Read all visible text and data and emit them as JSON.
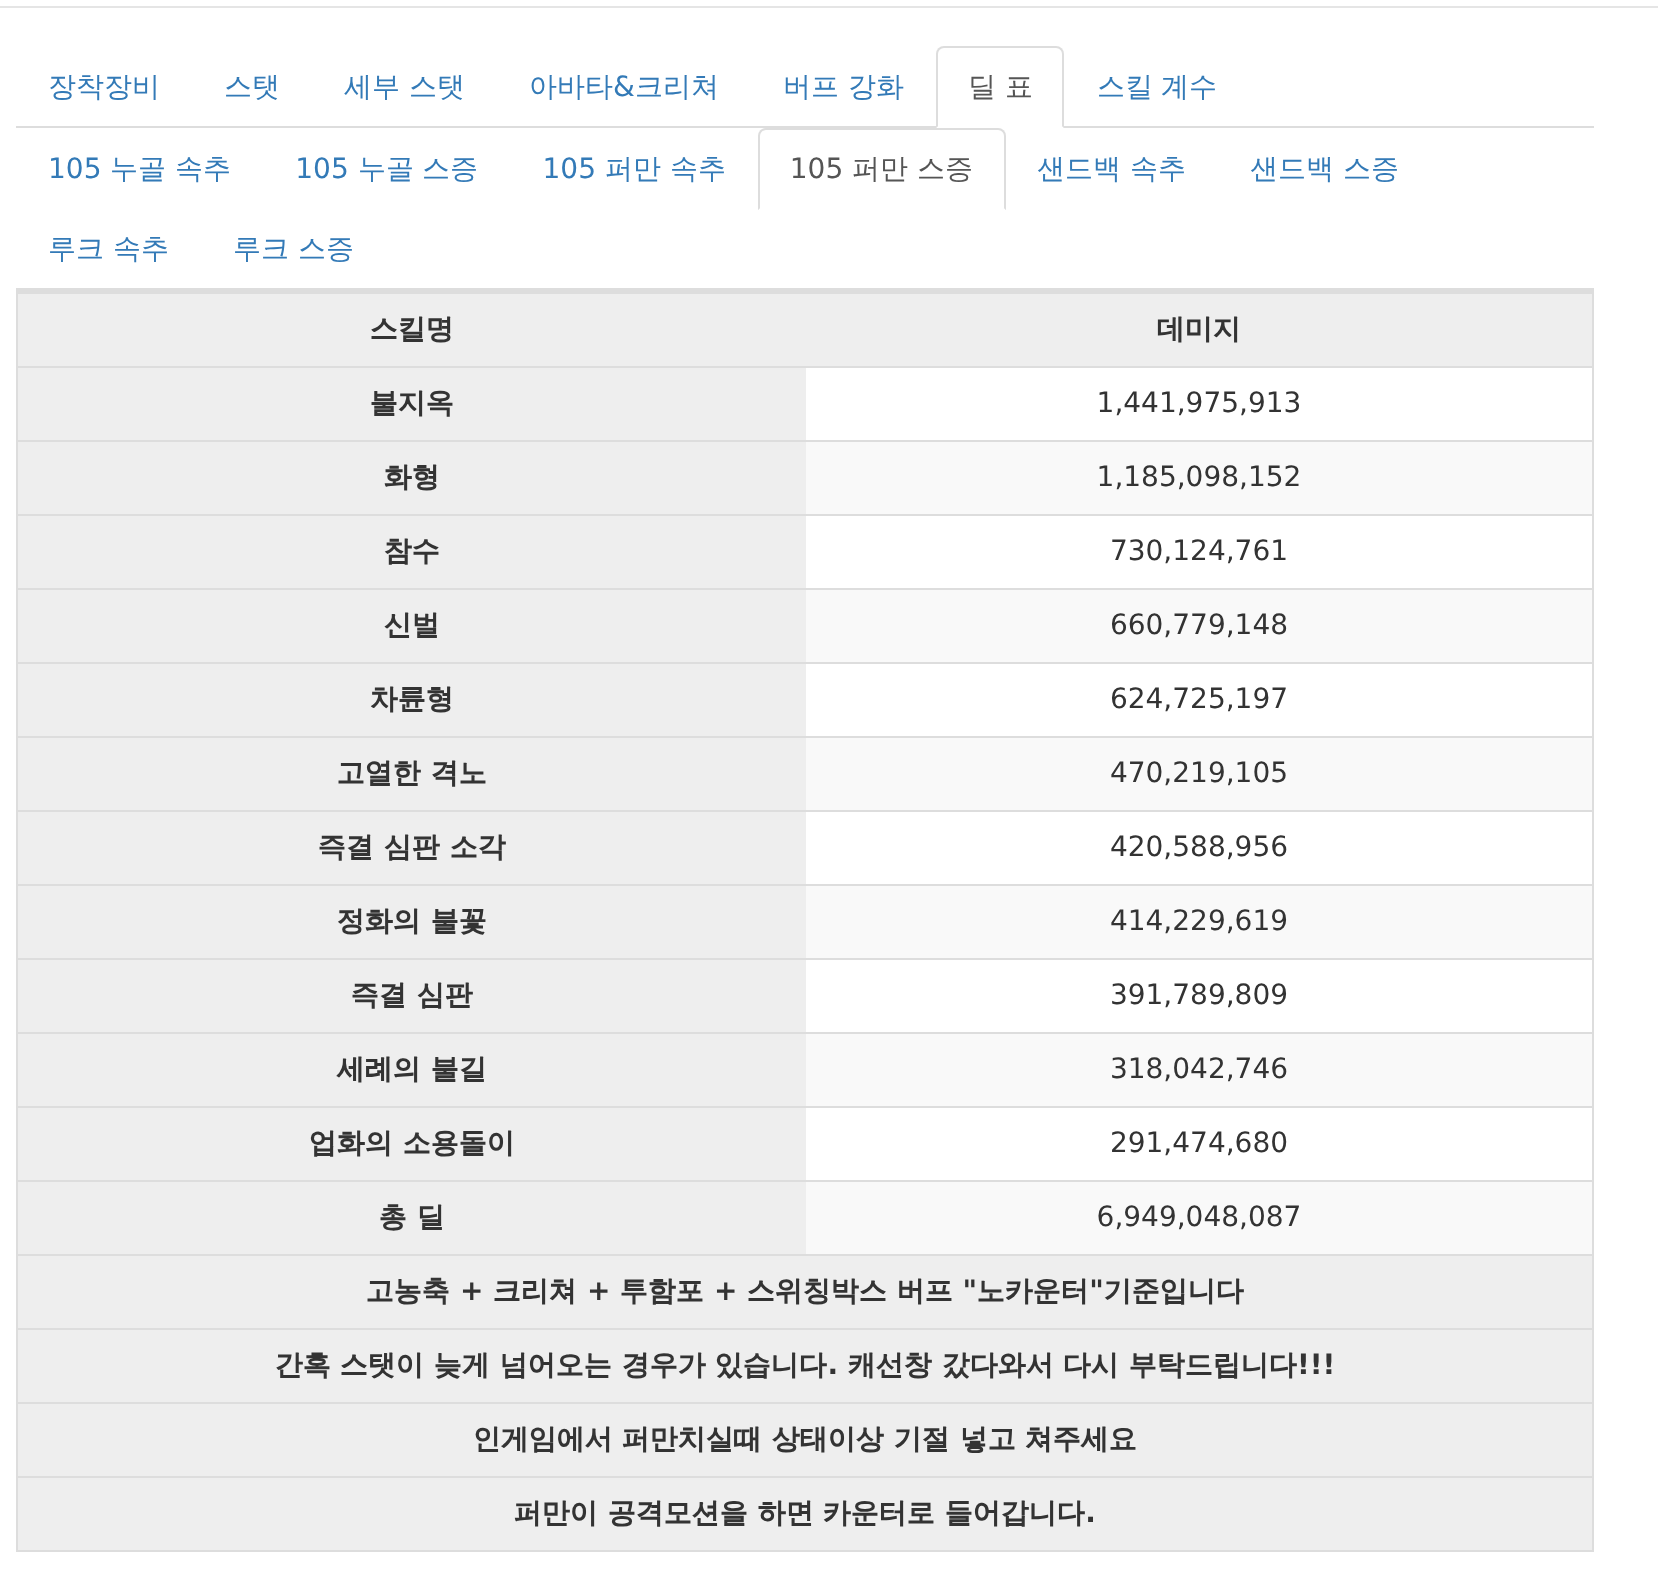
{
  "main_tabs": [
    {
      "label": "장착장비",
      "selected": false
    },
    {
      "label": "스탯",
      "selected": false
    },
    {
      "label": "세부 스탯",
      "selected": false
    },
    {
      "label": "아바타&크리쳐",
      "selected": false
    },
    {
      "label": "버프 강화",
      "selected": false
    },
    {
      "label": "딜 표",
      "selected": true
    },
    {
      "label": "스킬 계수",
      "selected": false
    }
  ],
  "sub_tabs": [
    {
      "label": "105 누골 속추",
      "selected": false
    },
    {
      "label": "105 누골 스증",
      "selected": false
    },
    {
      "label": "105 퍼만 속추",
      "selected": false
    },
    {
      "label": "105 퍼만 스증",
      "selected": true
    },
    {
      "label": "샌드백 속추",
      "selected": false
    },
    {
      "label": "샌드백 스증",
      "selected": false
    },
    {
      "label": "루크 속추",
      "selected": false
    },
    {
      "label": "루크 스증",
      "selected": false
    }
  ],
  "table": {
    "columns": [
      "스킬명",
      "데미지"
    ],
    "rows": [
      {
        "skill": "불지옥",
        "damage": "1,441,975,913"
      },
      {
        "skill": "화형",
        "damage": "1,185,098,152"
      },
      {
        "skill": "참수",
        "damage": "730,124,761"
      },
      {
        "skill": "신벌",
        "damage": "660,779,148"
      },
      {
        "skill": "차륜형",
        "damage": "624,725,197"
      },
      {
        "skill": "고열한 격노",
        "damage": "470,219,105"
      },
      {
        "skill": "즉결 심판 소각",
        "damage": "420,588,956"
      },
      {
        "skill": "정화의 불꽃",
        "damage": "414,229,619"
      },
      {
        "skill": "즉결 심판",
        "damage": "391,789,809"
      },
      {
        "skill": "세례의 불길",
        "damage": "318,042,746"
      },
      {
        "skill": "업화의 소용돌이",
        "damage": "291,474,680"
      },
      {
        "skill": "총 딜",
        "damage": "6,949,048,087"
      }
    ],
    "notes": [
      "고농축 + 크리쳐 + 투함포 + 스위칭박스 버프 \"노카운터\"기준입니다",
      "간혹 스탯이 늦게 넘어오는 경우가 있습니다. 캐선창 갔다와서 다시 부탁드립니다!!!",
      "인게임에서 퍼만치실때 상태이상 기절 넣고 쳐주세요",
      "퍼만이 공격모션을 하면 카운터로 들어갑니다."
    ]
  }
}
